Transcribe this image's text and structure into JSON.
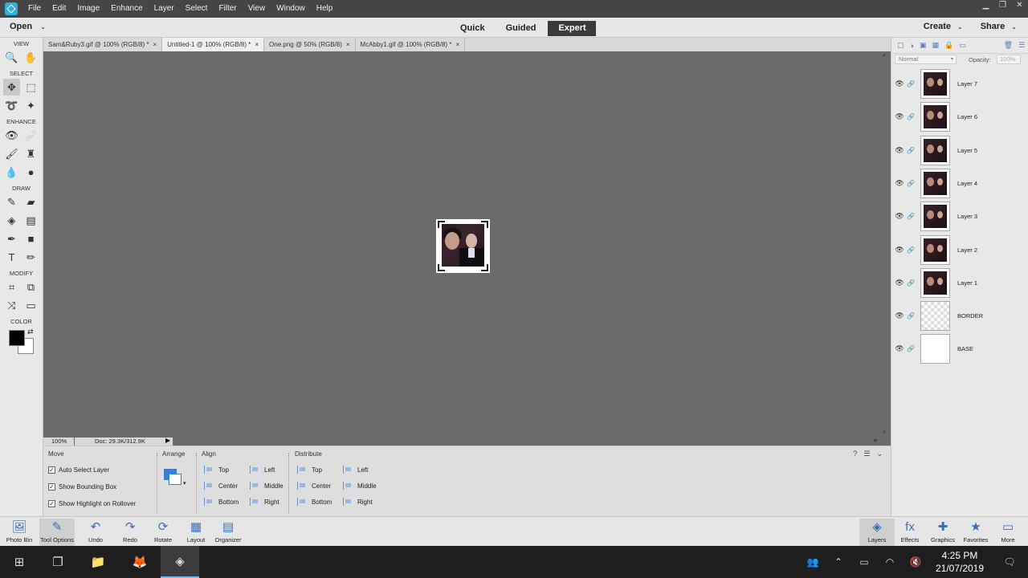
{
  "menu": {
    "items": [
      "File",
      "Edit",
      "Image",
      "Enhance",
      "Layer",
      "Select",
      "Filter",
      "View",
      "Window",
      "Help"
    ]
  },
  "window_controls": {
    "minimize": "▁",
    "restore": "❐",
    "close": "✕"
  },
  "modebar": {
    "open_label": "Open",
    "caret": "⌄",
    "modes": [
      "Quick",
      "Guided",
      "Expert"
    ],
    "active_mode": "Expert",
    "create_label": "Create",
    "share_label": "Share"
  },
  "toolbox": {
    "sections": {
      "view": "VIEW",
      "select": "SELECT",
      "enhance": "ENHANCE",
      "draw": "DRAW",
      "modify": "MODIFY",
      "color": "COLOR"
    },
    "tools": {
      "view": [
        {
          "name": "zoom-icon",
          "glyph": "🔍"
        },
        {
          "name": "hand-icon",
          "glyph": "✋"
        }
      ],
      "select1": [
        {
          "name": "move-icon",
          "glyph": "✥"
        },
        {
          "name": "marquee-icon",
          "glyph": "⬚"
        }
      ],
      "select2": [
        {
          "name": "lasso-icon",
          "glyph": "➰"
        },
        {
          "name": "magic-wand-icon",
          "glyph": "✦"
        }
      ],
      "enhance1": [
        {
          "name": "red-eye-icon",
          "glyph": "👁"
        },
        {
          "name": "healing-icon",
          "glyph": "🩹"
        }
      ],
      "enhance2": [
        {
          "name": "smart-brush-icon",
          "glyph": "🖌"
        },
        {
          "name": "clone-stamp-icon",
          "glyph": "♜"
        }
      ],
      "enhance3": [
        {
          "name": "blur-icon",
          "glyph": "💧"
        },
        {
          "name": "sponge-icon",
          "glyph": "●"
        }
      ],
      "draw1": [
        {
          "name": "brush-icon",
          "glyph": "✎"
        },
        {
          "name": "eraser-icon",
          "glyph": "▰"
        }
      ],
      "draw2": [
        {
          "name": "paint-bucket-icon",
          "glyph": "◈"
        },
        {
          "name": "gradient-icon",
          "glyph": "▤"
        }
      ],
      "draw3": [
        {
          "name": "eyedropper-icon",
          "glyph": "✒"
        },
        {
          "name": "shape-icon",
          "glyph": "■"
        }
      ],
      "draw4": [
        {
          "name": "type-icon",
          "glyph": "T"
        },
        {
          "name": "pencil-icon",
          "glyph": "✏"
        }
      ],
      "modify1": [
        {
          "name": "crop-icon",
          "glyph": "⌗"
        },
        {
          "name": "recompose-icon",
          "glyph": "⧉"
        }
      ],
      "modify2": [
        {
          "name": "content-aware-move-icon",
          "glyph": "⤨"
        },
        {
          "name": "straighten-icon",
          "glyph": "▭"
        }
      ]
    },
    "colors": {
      "foreground": "#000000",
      "background": "#ffffff"
    }
  },
  "doc_tabs": [
    {
      "label": "Sam&Ruby3.gif @ 100% (RGB/8) *",
      "active": false
    },
    {
      "label": "Untitled-1 @ 100% (RGB/8) *",
      "active": true
    },
    {
      "label": "One.png @ 50% (RGB/8)",
      "active": false
    },
    {
      "label": "McAbby1.gif @ 100% (RGB/8) *",
      "active": false
    }
  ],
  "tab_close": "×",
  "status": {
    "zoom": "100%",
    "doc_info": "Doc: 29.3K/312.9K",
    "arrow": "▶"
  },
  "tool_options": {
    "move_title": "Move",
    "checkboxes": [
      {
        "label": "Auto Select Layer",
        "checked": true
      },
      {
        "label": "Show Bounding Box",
        "checked": true
      },
      {
        "label": "Show Highlight on Rollover",
        "checked": true
      }
    ],
    "check_mark": "✓",
    "arrange_title": "Arrange",
    "align_title": "Align",
    "align": [
      "Top",
      "Center",
      "Bottom",
      "Left",
      "Middle",
      "Right"
    ],
    "distribute_title": "Distribute",
    "distribute": [
      "Top",
      "Center",
      "Bottom",
      "Left",
      "Middle",
      "Right"
    ],
    "panel_icons": [
      "?",
      "☰",
      "⌄"
    ]
  },
  "layers_panel": {
    "blend_mode": "Normal",
    "opacity_label": "Opacity:",
    "opacity_value": "100%",
    "eye": "👁",
    "link": "🔗",
    "layers": [
      {
        "name": "Layer 7",
        "thumb": "photo"
      },
      {
        "name": "Layer 6",
        "thumb": "photo"
      },
      {
        "name": "Layer 5",
        "thumb": "photo"
      },
      {
        "name": "Layer 4",
        "thumb": "photo"
      },
      {
        "name": "Layer 3",
        "thumb": "photo"
      },
      {
        "name": "Layer 2",
        "thumb": "photo"
      },
      {
        "name": "Layer 1",
        "thumb": "photo"
      },
      {
        "name": "BORDER",
        "thumb": "transparent"
      },
      {
        "name": "BASE",
        "thumb": "white"
      }
    ]
  },
  "bottom_bar": {
    "left": [
      {
        "label": "Photo Bin",
        "icon": "🖼"
      },
      {
        "label": "Tool Options",
        "icon": "✎",
        "active": true
      },
      {
        "label": "Undo",
        "icon": "↶"
      },
      {
        "label": "Redo",
        "icon": "↷"
      },
      {
        "label": "Rotate",
        "icon": "⟳"
      },
      {
        "label": "Layout",
        "icon": "▦"
      },
      {
        "label": "Organizer",
        "icon": "▤"
      }
    ],
    "right": [
      {
        "label": "Layers",
        "icon": "◈",
        "active": true
      },
      {
        "label": "Effects",
        "icon": "fx"
      },
      {
        "label": "Graphics",
        "icon": "✚"
      },
      {
        "label": "Favorites",
        "icon": "★"
      },
      {
        "label": "More",
        "icon": "▭"
      }
    ]
  },
  "taskbar": {
    "apps": [
      {
        "name": "windows-start-icon",
        "glyph": "⊞"
      },
      {
        "name": "task-view-icon",
        "glyph": "❐"
      },
      {
        "name": "file-explorer-icon",
        "glyph": "📁"
      },
      {
        "name": "firefox-icon",
        "glyph": "🦊"
      },
      {
        "name": "photoshop-elements-icon",
        "glyph": "◈"
      }
    ],
    "tray": [
      "👥",
      "⌃",
      "▭",
      "◠",
      "🔇"
    ],
    "time": "4:25 PM",
    "date": "21/07/2019",
    "notification_icon": "🗨"
  }
}
